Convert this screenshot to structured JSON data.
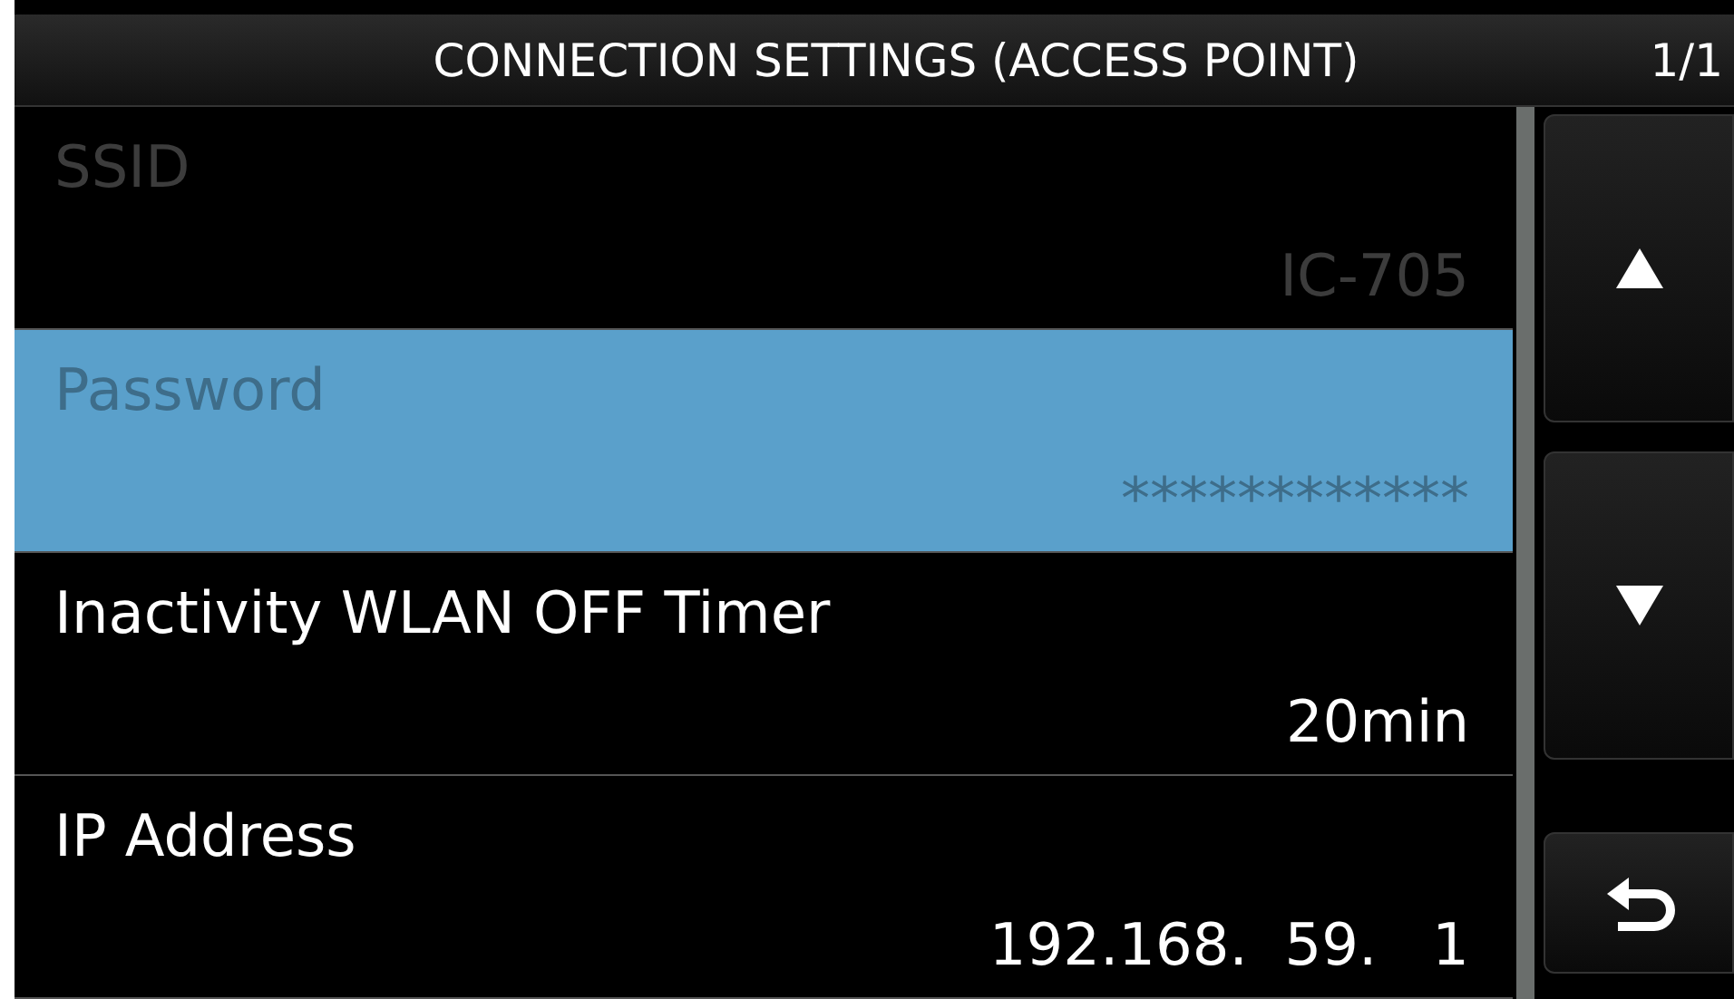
{
  "title": "CONNECTION SETTINGS (ACCESS POINT)",
  "page": "1/1",
  "items": [
    {
      "label": "SSID",
      "value": "IC-705",
      "disabled": true,
      "selected": false
    },
    {
      "label": "Password",
      "value": "************",
      "disabled": true,
      "selected": true
    },
    {
      "label": "Inactivity WLAN OFF Timer",
      "value": "20min",
      "disabled": false,
      "selected": false
    },
    {
      "label": "IP Address",
      "value": "192.168.  59.   1",
      "disabled": false,
      "selected": false
    }
  ]
}
